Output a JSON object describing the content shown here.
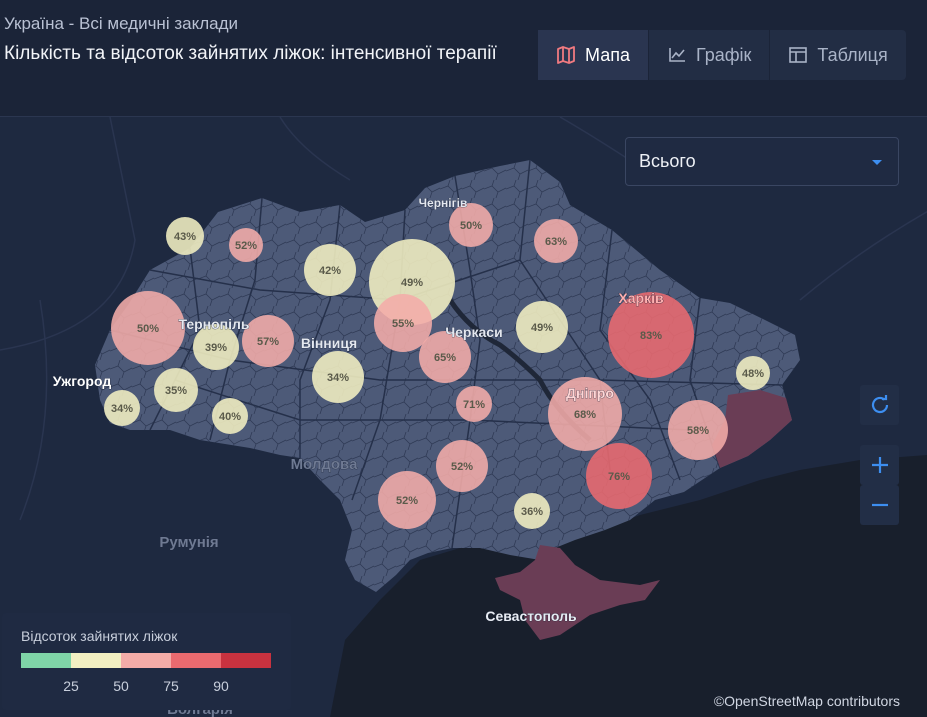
{
  "header": {
    "breadcrumb": "Україна - Всі медичні заклади",
    "title": "Кількість та відсоток зайнятих ліжок: інтенсивної терапії"
  },
  "tabs": [
    {
      "label": "Мапа",
      "icon": "map-icon",
      "active": true
    },
    {
      "label": "Графік",
      "icon": "line-chart-icon",
      "active": false
    },
    {
      "label": "Таблиця",
      "icon": "table-icon",
      "active": false
    }
  ],
  "filter": {
    "selected": "Всього"
  },
  "controls": {
    "reset": "refresh-icon",
    "zoom_in": "+",
    "zoom_out": "−"
  },
  "place_labels": [
    "Чернігів",
    "Тернопіль",
    "Вінниця",
    "Ужгород",
    "Черкаси",
    "Харків",
    "Дніпро",
    "Молдова",
    "Румунія",
    "Севастополь",
    "Болгарія"
  ],
  "regions": [
    {
      "value": 43,
      "label": "43%"
    },
    {
      "value": 52,
      "label": "52%"
    },
    {
      "value": 42,
      "label": "42%"
    },
    {
      "value": 49,
      "label": "49%"
    },
    {
      "value": 50,
      "label": "50%"
    },
    {
      "value": 63,
      "label": "63%"
    },
    {
      "value": 50,
      "label": "50%"
    },
    {
      "value": 39,
      "label": "39%"
    },
    {
      "value": 57,
      "label": "57%"
    },
    {
      "value": 55,
      "label": "55%"
    },
    {
      "value": 65,
      "label": "65%"
    },
    {
      "value": 49,
      "label": "49%"
    },
    {
      "value": 83,
      "label": "83%"
    },
    {
      "value": 34,
      "label": "34%"
    },
    {
      "value": 35,
      "label": "35%"
    },
    {
      "value": 34,
      "label": "34%"
    },
    {
      "value": 40,
      "label": "40%"
    },
    {
      "value": 71,
      "label": "71%"
    },
    {
      "value": 68,
      "label": "68%"
    },
    {
      "value": 58,
      "label": "58%"
    },
    {
      "value": 48,
      "label": "48%"
    },
    {
      "value": 52,
      "label": "52%"
    },
    {
      "value": 76,
      "label": "76%"
    },
    {
      "value": 52,
      "label": "52%"
    },
    {
      "value": 36,
      "label": "36%"
    }
  ],
  "legend": {
    "title": "Відсоток зайнятих ліжок",
    "colors": [
      "#7fd5a8",
      "#f2efc2",
      "#f4aca8",
      "#ea6a6f",
      "#c8323f"
    ],
    "ticks": [
      "25",
      "50",
      "75",
      "90"
    ]
  },
  "attribution": "©OpenStreetMap contributors"
}
